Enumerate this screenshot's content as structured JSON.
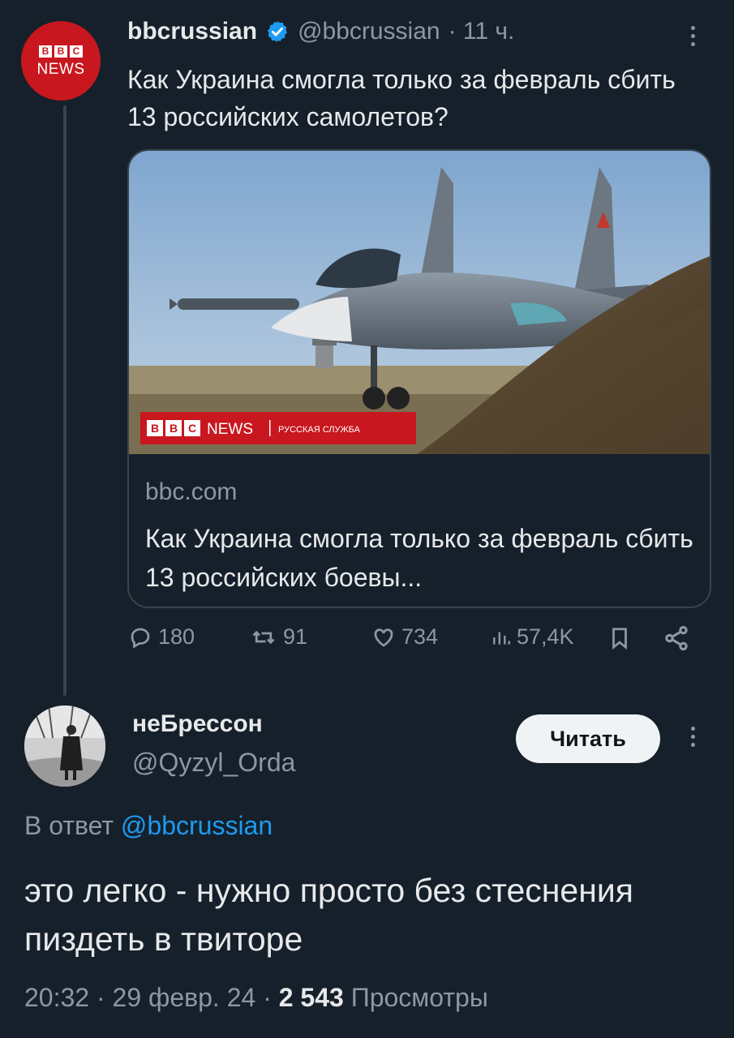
{
  "parent_tweet": {
    "avatar_text": {
      "blocks": [
        "B",
        "B",
        "C"
      ],
      "word": "NEWS"
    },
    "display_name": "bbcrussian",
    "handle": "@bbcrussian",
    "time": "· 11 ч.",
    "text": "Как Украина смогла только за февраль сбить 13 российских самолетов?",
    "card": {
      "banner_brand": "NEWS",
      "banner_service": "РУССКАЯ СЛУЖБА",
      "domain": "bbc.com",
      "title": "Как Украина смогла только за февраль сбить 13 российских боевы..."
    },
    "actions": {
      "replies": "180",
      "retweets": "91",
      "likes": "734",
      "views": "57,4K"
    }
  },
  "reply_tweet": {
    "display_name": "неБрессон",
    "handle": "@Qyzyl_Orda",
    "follow_label": "Читать",
    "reply_prefix": "В ответ",
    "reply_to_handle": "@bbcrussian",
    "text": "это легко - нужно просто без стеснения пиздеть в твиторе",
    "time": "20:32 · 29 февр. 24 ·",
    "views_count": "2 543",
    "views_label": "Просмотры"
  },
  "colors": {
    "background": "#15202b",
    "text": "#e7e9ea",
    "muted": "#8b98a5",
    "link": "#1d9bf0",
    "bbc_red": "#c8171f"
  }
}
